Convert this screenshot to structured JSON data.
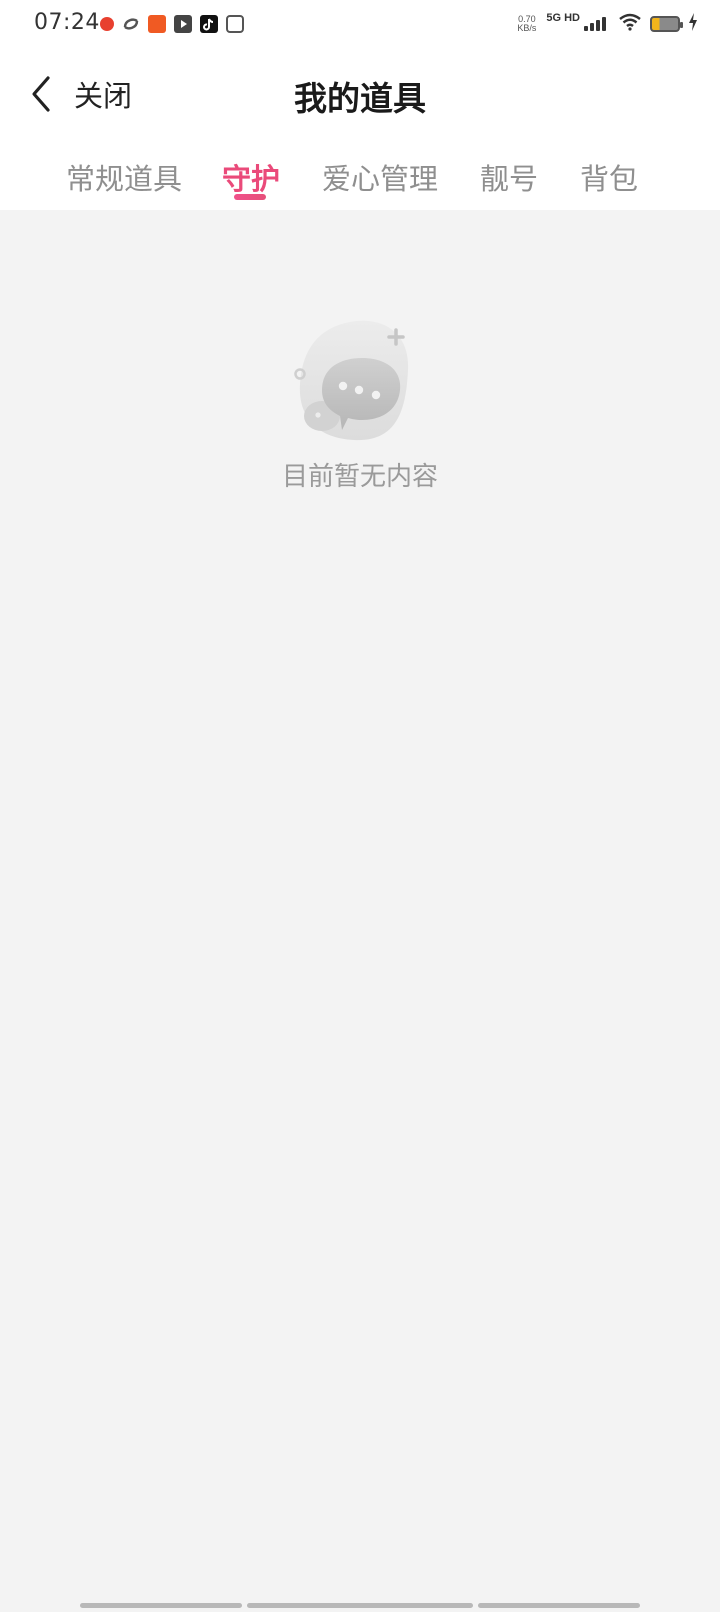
{
  "status_bar": {
    "time": "07:24",
    "net_speed_value": "0.70",
    "net_speed_unit": "KB/s",
    "network_label": "5G HD",
    "icons": [
      "app-notification-icon",
      "sync-icon",
      "app-icon",
      "video-app-icon",
      "tiktok-icon",
      "search-app-icon",
      "signal-icon",
      "wifi-icon",
      "battery-icon",
      "charging-icon"
    ],
    "battery_level": 0.28,
    "battery_color": "#f2b51c"
  },
  "header": {
    "back_label": "关闭",
    "title": "我的道具"
  },
  "tabs": [
    {
      "label": "常规道具",
      "active": false
    },
    {
      "label": "守护",
      "active": true
    },
    {
      "label": "爱心管理",
      "active": false
    },
    {
      "label": "靓号",
      "active": false
    },
    {
      "label": "背包",
      "active": false
    }
  ],
  "accent_color": "#ea4a7a",
  "empty_state": {
    "text": "目前暂无内容",
    "icon": "empty-chat-icon"
  }
}
